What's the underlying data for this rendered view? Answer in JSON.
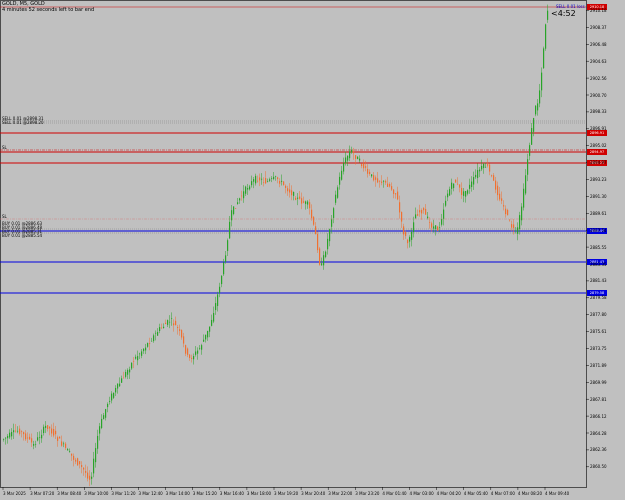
{
  "header": {
    "symbol_line": "GOLD, M5, GOLD",
    "info_line": "4 minutes 52 seconds left to bar end",
    "bar_timer": "<4:52"
  },
  "price_axis": {
    "labels": [
      "2910.18",
      "2908.37",
      "2906.48",
      "2904.63",
      "2902.56",
      "2900.70",
      "2898.33",
      "2896.91",
      "2895.02",
      "2894.97",
      "2893.23",
      "2891.30",
      "2889.61",
      "2887.54",
      "2885.55",
      "2883.35",
      "2881.43",
      "2879.58",
      "2877.80",
      "2875.61",
      "2873.75",
      "2871.89",
      "2869.99",
      "2867.81",
      "2866.12",
      "2864.28",
      "2862.36",
      "2860.50"
    ]
  },
  "time_axis": {
    "labels": [
      "3 Mar 2025",
      "3 Mar 07:20",
      "3 Mar 08:40",
      "3 Mar 10:00",
      "3 Mar 11:20",
      "3 Mar 12:40",
      "3 Mar 14:00",
      "3 Mar 15:20",
      "3 Mar 16:40",
      "3 Mar 18:00",
      "3 Mar 19:20",
      "3 Mar 20:40",
      "3 Mar 22:00",
      "3 Mar 23:20",
      "4 Mar 01:40",
      "4 Mar 03:00",
      "4 Mar 04:20",
      "4 Mar 05:40",
      "4 Mar 07:00",
      "4 Mar 08:20",
      "4 Mar 09:40"
    ]
  },
  "level_labels": {
    "sell_cluster": [
      "SELL 0.01 @2898.31",
      "SELL 0.01 @2898.20"
    ],
    "sl_upper": "SL",
    "sl_lower": "SL",
    "buy_cluster": [
      "BUY 0.01 @2886.63",
      "BUY 0.01 @2886.48",
      "BUY 0.01 @2885.31",
      "BUY 0.01 @2885.54"
    ],
    "bid_tag": "SELL 0.01 loss 142.10 €"
  },
  "price_tags": {
    "top": "2910.18",
    "red1": "2896.91",
    "red2": "2894.97",
    "red3": "2893.23",
    "blue1": "2886.45",
    "blue2": "2881.43",
    "blue3": "2879.58"
  },
  "colors": {
    "background": "#c0c0c0",
    "bull_candle": "#28a428",
    "bear_candle": "#f07030",
    "sell_line": "#d00000",
    "buy_line": "#0000e0"
  }
}
